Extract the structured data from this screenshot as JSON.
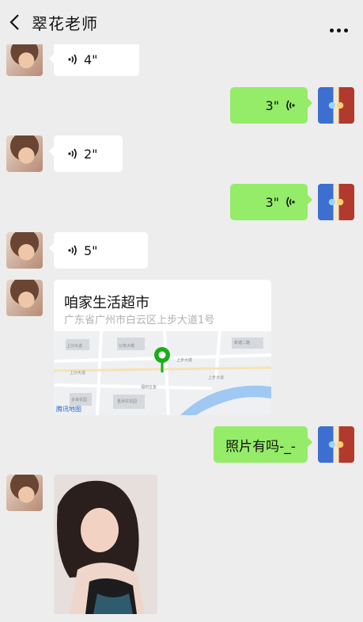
{
  "header": {
    "title": "翠花老师",
    "back_icon": "chevron-left-icon",
    "more_icon": "more-dots-icon"
  },
  "messages": {
    "voice1": {
      "duration": "4\""
    },
    "voice2": {
      "duration": "3\""
    },
    "voice3": {
      "duration": "2\""
    },
    "voice4": {
      "duration": "3\""
    },
    "voice5": {
      "duration": "5\""
    },
    "location": {
      "name": "咱家生活超市",
      "address": "广东省广州市白云区上步大道1号",
      "map_provider": "腾讯地图"
    },
    "text1": {
      "text": "照片有吗-_-"
    }
  },
  "colors": {
    "background": "#ededed",
    "outgoing_bubble": "#95ec69",
    "incoming_bubble": "#ffffff",
    "map_pin": "#1aad19"
  }
}
